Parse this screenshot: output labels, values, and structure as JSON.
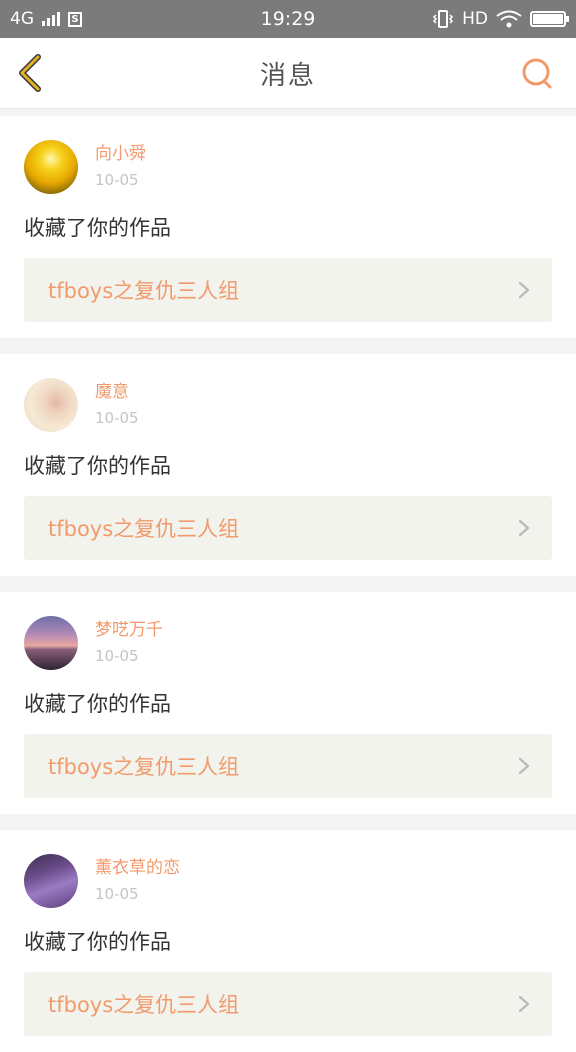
{
  "status_bar": {
    "network": "4G",
    "sim_label": "S",
    "time": "19:29",
    "hd": "HD",
    "battery_level": 1.0
  },
  "header": {
    "title": "消息",
    "back_icon": "chevron-left-icon",
    "search_icon": "search-icon"
  },
  "colors": {
    "accent": "#f29a6b",
    "back_icon": "#e4b21e",
    "status_bar": "#7b7b7b"
  },
  "messages": [
    {
      "user": "向小舜",
      "date": "10-05",
      "action": "收藏了你的作品",
      "work_title": "tfboys之复仇三人组"
    },
    {
      "user": "魔意",
      "date": "10-05",
      "action": "收藏了你的作品",
      "work_title": "tfboys之复仇三人组"
    },
    {
      "user": "梦呓万千",
      "date": "10-05",
      "action": "收藏了你的作品",
      "work_title": "tfboys之复仇三人组"
    },
    {
      "user": "薰衣草的恋",
      "date": "10-05",
      "action": "收藏了你的作品",
      "work_title": "tfboys之复仇三人组"
    }
  ]
}
